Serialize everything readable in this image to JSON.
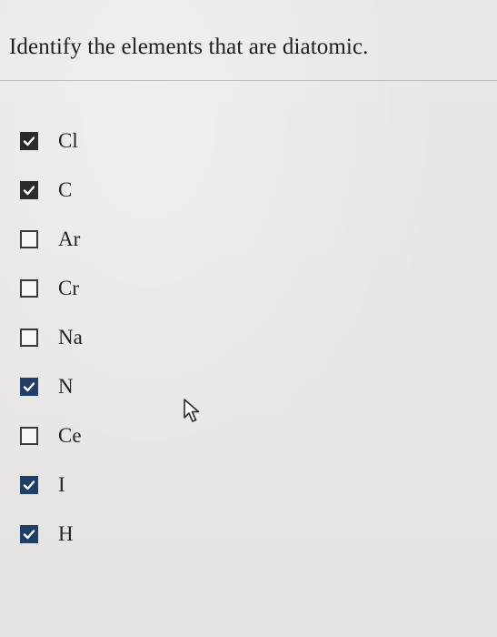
{
  "question": {
    "prompt": "Identify the elements that are diatomic."
  },
  "options": [
    {
      "label": "Cl",
      "checked": true
    },
    {
      "label": "C",
      "checked": true
    },
    {
      "label": "Ar",
      "checked": false
    },
    {
      "label": "Cr",
      "checked": false
    },
    {
      "label": "Na",
      "checked": false
    },
    {
      "label": "N",
      "checked": true
    },
    {
      "label": "Ce",
      "checked": false
    },
    {
      "label": "I",
      "checked": true
    },
    {
      "label": "H",
      "checked": true
    }
  ],
  "colors": {
    "checked_fill": "#2b2b2b",
    "checked_fill_highlight": "#1f3f66",
    "checkmark": "#ffffff",
    "text": "#232323"
  },
  "icons": {
    "checkmark": "check-icon",
    "pointer": "mouse-cursor-icon"
  }
}
